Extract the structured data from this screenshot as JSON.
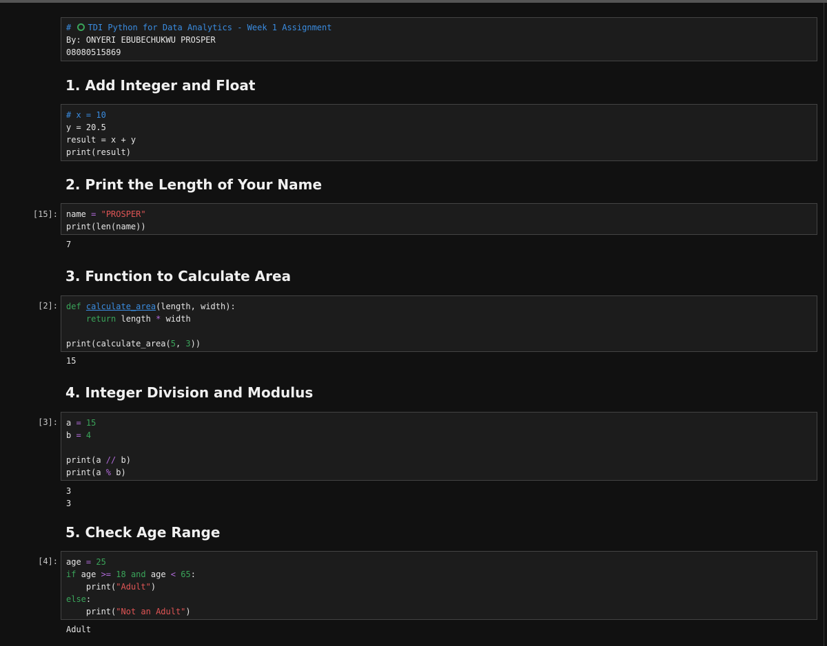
{
  "md0": {
    "hash": "#",
    "title": "TDI Python for Data Analytics - Week 1 Assignment",
    "author": "By: ONYERI EBUBECHUKWU PROSPER",
    "phone": "08080515869"
  },
  "h1": "1. Add Integer and Float",
  "c1": {
    "l1": "# x = 10",
    "l2": "y = 20.5",
    "l3": "result = x + y",
    "l4": "print(result)"
  },
  "h2": "2. Print the Length of Your Name",
  "p2": "[15]:",
  "c2": {
    "var": "name",
    "eq": " = ",
    "str": "\"PROSPER\"",
    "l2": "print(len(name))"
  },
  "o2": "7",
  "h3": "3. Function to Calculate Area",
  "p3": "[2]:",
  "c3": {
    "def": "def",
    "fname": "calculate_area",
    "params": "(length, width):",
    "ret": "return",
    "expr1": "length",
    "op": "*",
    "expr2": "width",
    "call1": "print(calculate_area(",
    "n1": "5",
    "comma": ", ",
    "n2": "3",
    "call2": "))"
  },
  "o3": "15",
  "h4": "4. Integer Division and Modulus",
  "p4": "[3]:",
  "c4": {
    "a": "a",
    "eq": " = ",
    "a_val": "15",
    "b": "b",
    "b_val": "4",
    "pa1": "print(a ",
    "floordiv": "//",
    "pa2": " b)",
    "pb1": "print(a ",
    "mod": "%",
    "pb2": " b)"
  },
  "o4": {
    "l1": "3",
    "l2": "3"
  },
  "h5": "5. Check Age Range",
  "p5": "[4]:",
  "c5": {
    "age": "age",
    "eq": " = ",
    "age_val": "25",
    "if": "if",
    "cond1": " age ",
    "ge": ">=",
    "n18": "18",
    "and": "and",
    "cond2": " age ",
    "lt": "<",
    "n65": "65",
    "colon": ":",
    "print1a": "print(",
    "s1": "\"Adult\"",
    "print1b": ")",
    "else": "else",
    "print2a": "print(",
    "s2": "\"Not an Adult\"",
    "print2b": ")"
  },
  "o5": "Adult"
}
